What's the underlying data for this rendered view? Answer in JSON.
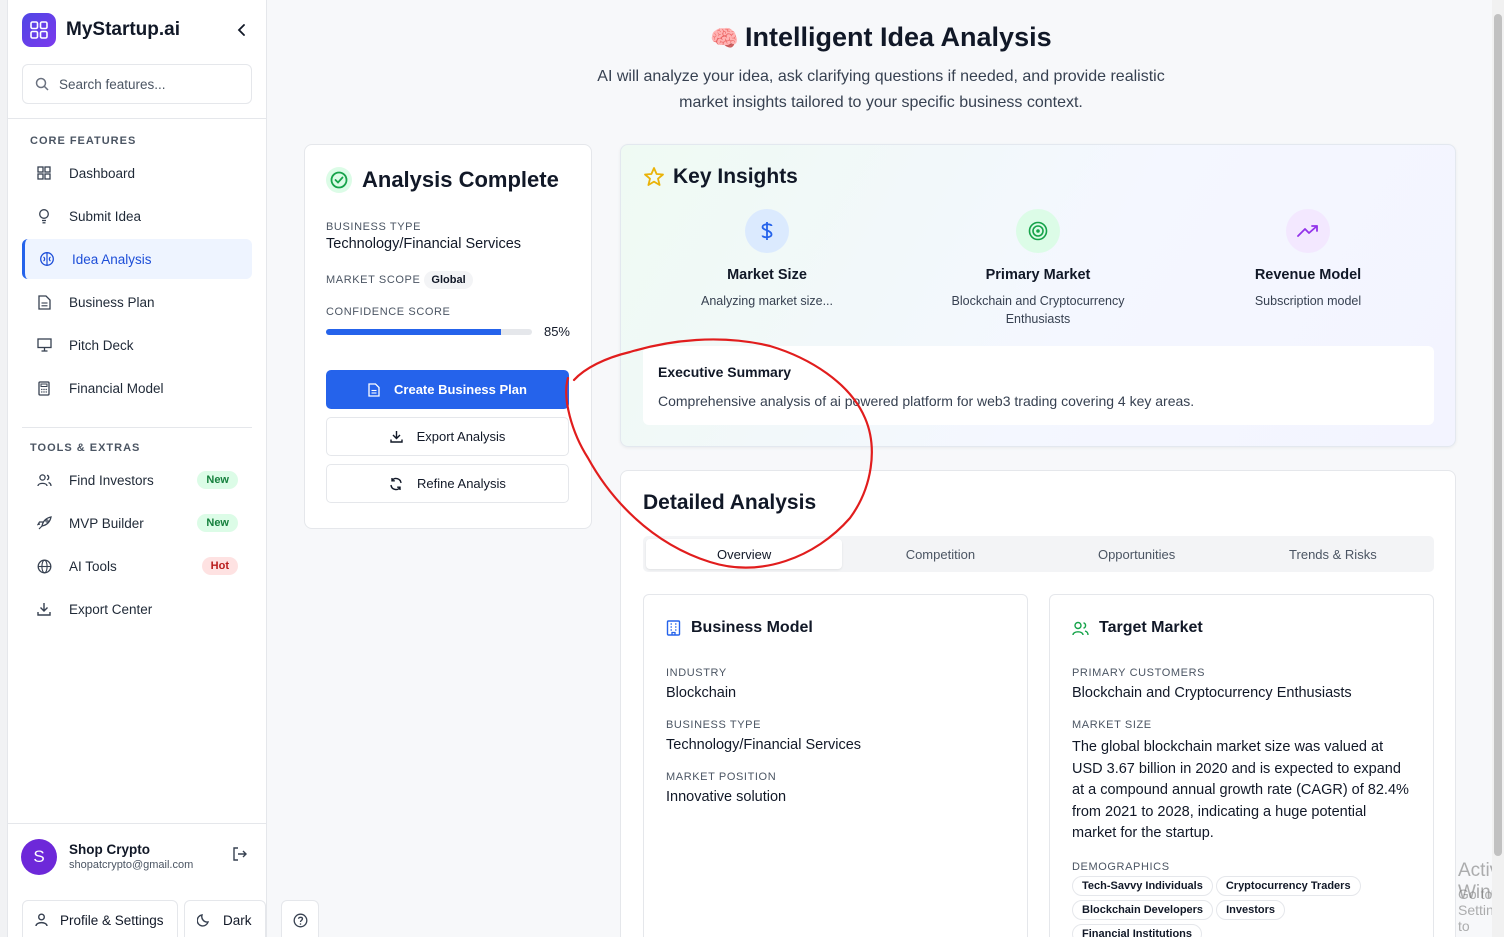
{
  "brand": {
    "name": "MyStartup.ai"
  },
  "search": {
    "placeholder": "Search features..."
  },
  "sidebar": {
    "core_title": "CORE FEATURES",
    "core_items": [
      {
        "label": "Dashboard",
        "icon": "grid-icon"
      },
      {
        "label": "Submit Idea",
        "icon": "lightbulb-icon"
      },
      {
        "label": "Idea Analysis",
        "icon": "brain-icon",
        "active": true
      },
      {
        "label": "Business Plan",
        "icon": "document-icon"
      },
      {
        "label": "Pitch Deck",
        "icon": "presentation-icon"
      },
      {
        "label": "Financial Model",
        "icon": "calculator-icon"
      }
    ],
    "tools_title": "TOOLS & EXTRAS",
    "tools_items": [
      {
        "label": "Find Investors",
        "icon": "users-icon",
        "badge": "New"
      },
      {
        "label": "MVP Builder",
        "icon": "rocket-icon",
        "badge": "New"
      },
      {
        "label": "AI Tools",
        "icon": "globe-icon",
        "badge": "Hot"
      },
      {
        "label": "Export Center",
        "icon": "download-icon"
      }
    ]
  },
  "user": {
    "initial": "S",
    "name": "Shop Crypto",
    "email": "shopatcrypto@gmail.com"
  },
  "bottom": {
    "profile_label": "Profile & Settings",
    "dark_label": "Dark"
  },
  "hero": {
    "icon": "🧠",
    "title": "Intelligent Idea Analysis",
    "subtitle": "AI will analyze your idea, ask clarifying questions if needed, and provide realistic market insights tailored to your specific business context."
  },
  "analysis": {
    "title": "Analysis Complete",
    "business_type_label": "BUSINESS TYPE",
    "business_type": "Technology/Financial Services",
    "market_scope_label": "MARKET SCOPE",
    "market_scope": "Global",
    "confidence_label": "CONFIDENCE SCORE",
    "confidence_text": "85%",
    "confidence_value": 0.85,
    "create_btn": "Create Business Plan",
    "export_btn": "Export Analysis",
    "refine_btn": "Refine Analysis"
  },
  "insights": {
    "title": "Key Insights",
    "items": [
      {
        "title": "Market Size",
        "text": "Analyzing market size...",
        "icon": "dollar-icon"
      },
      {
        "title": "Primary Market",
        "text": "Blockchain and Cryptocurrency Enthusiasts",
        "icon": "target-icon"
      },
      {
        "title": "Revenue Model",
        "text": "Subscription model",
        "icon": "trending-up-icon"
      }
    ],
    "exec_title": "Executive Summary",
    "exec_text": "Comprehensive analysis of ai powered platform for web3 trading covering 4 key areas."
  },
  "detail": {
    "title": "Detailed Analysis",
    "tabs": [
      "Overview",
      "Competition",
      "Opportunities",
      "Trends & Risks"
    ],
    "business_model": {
      "title": "Business Model",
      "industry_label": "INDUSTRY",
      "industry": "Blockchain",
      "type_label": "BUSINESS TYPE",
      "type": "Technology/Financial Services",
      "position_label": "MARKET POSITION",
      "position": "Innovative solution"
    },
    "target_market": {
      "title": "Target Market",
      "customers_label": "PRIMARY CUSTOMERS",
      "customers": "Blockchain and Cryptocurrency Enthusiasts",
      "size_label": "MARKET SIZE",
      "size": "The global blockchain market size was valued at USD 3.67 billion in 2020 and is expected to expand at a compound annual growth rate (CAGR) of 82.4% from 2021 to 2028, indicating a huge potential market for the startup.",
      "demographics_label": "DEMOGRAPHICS",
      "demographics": [
        "Tech-Savvy Individuals",
        "Cryptocurrency Traders",
        "Blockchain Developers",
        "Investors",
        "Financial Institutions"
      ]
    }
  },
  "watermark": {
    "line1": "Activate Windows",
    "line2": "Go to Settings to activate Windows."
  },
  "colors": {
    "accent": "#2563eb",
    "annotation": "#e11d1d"
  }
}
